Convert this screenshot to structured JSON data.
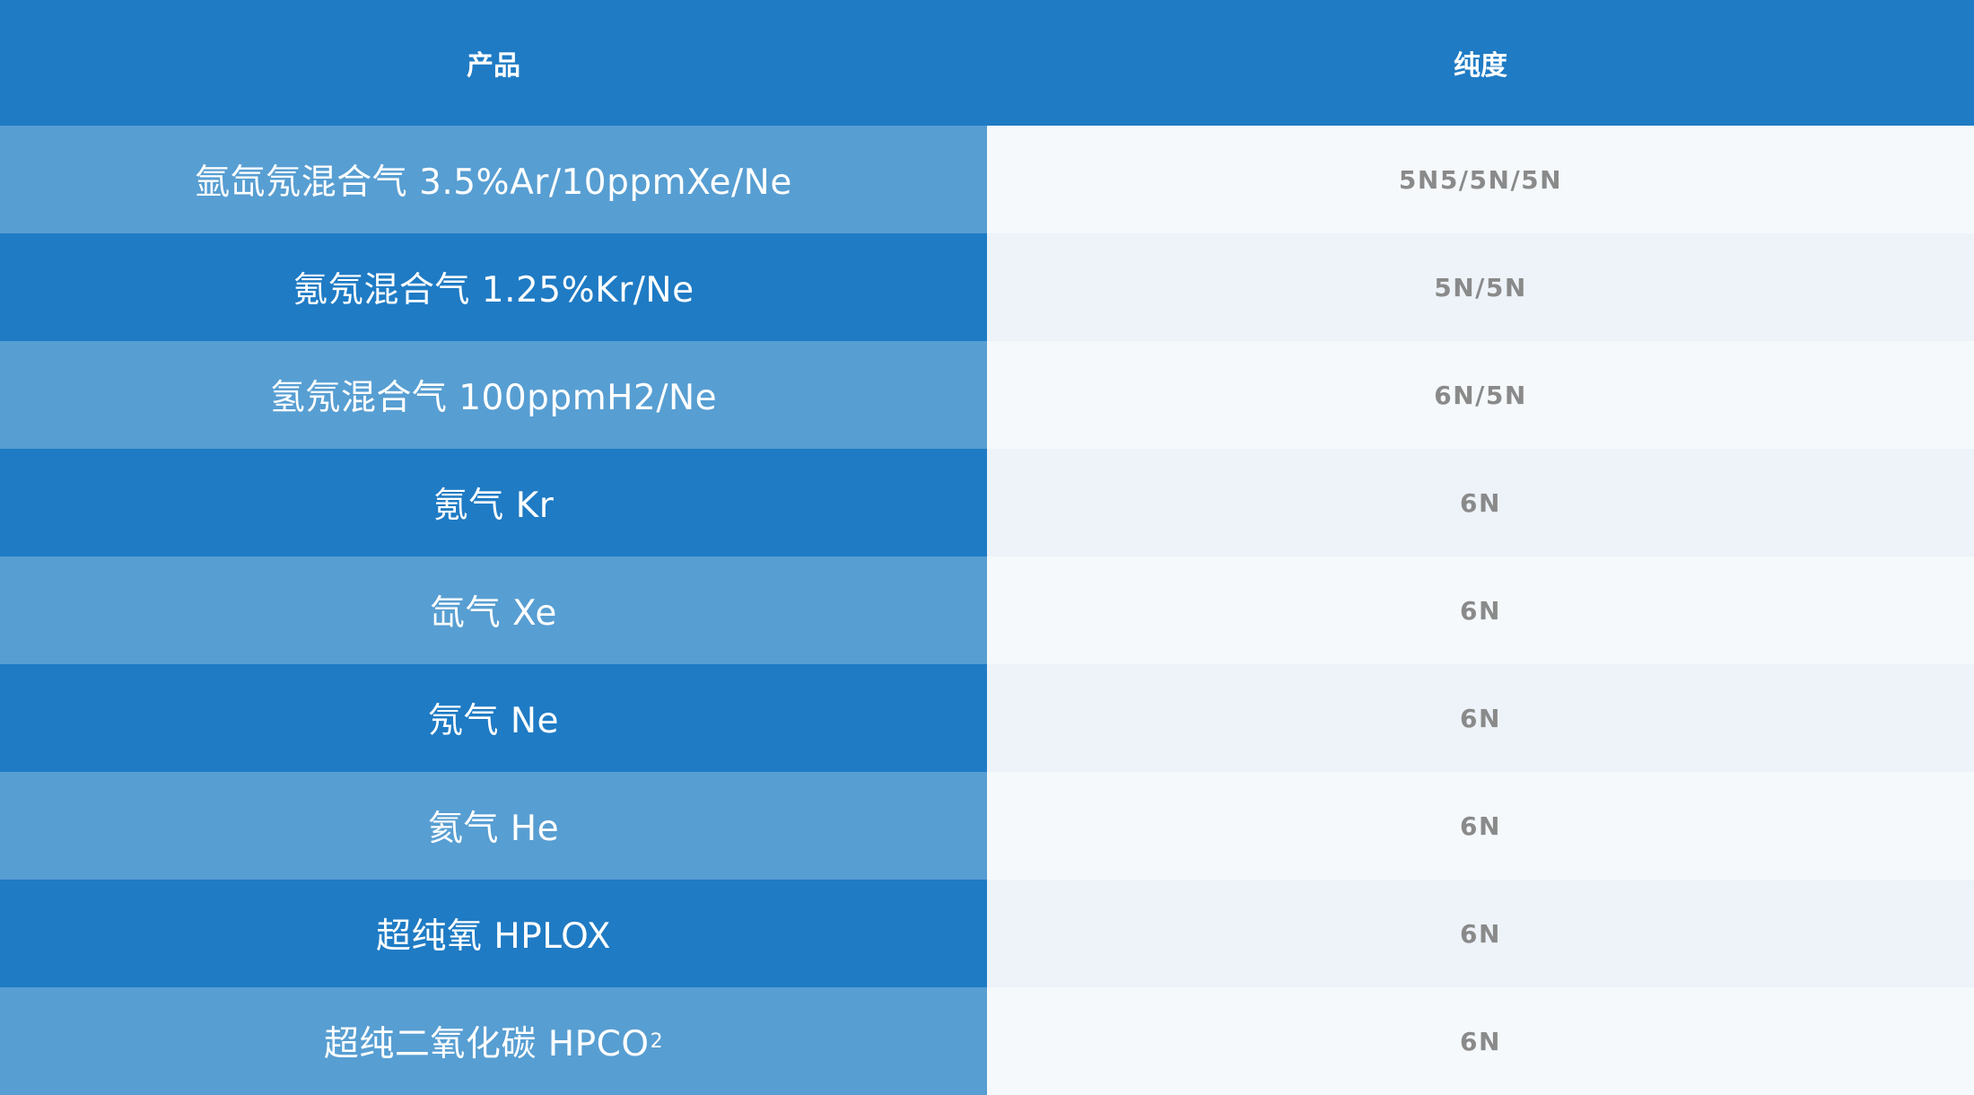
{
  "header": {
    "product_label": "产品",
    "purity_label": "纯度"
  },
  "rows": [
    {
      "product": "氩氙氖混合气 3.5%Ar/10ppmXe/Ne",
      "purity": "5N5/5N/5N"
    },
    {
      "product": "氪氖混合气 1.25%Kr/Ne",
      "purity": "5N/5N"
    },
    {
      "product": "氢氖混合气 100ppmH2/Ne",
      "purity": "6N/5N"
    },
    {
      "product": "氪气 Kr",
      "purity": "6N"
    },
    {
      "product": "氙气 Xe",
      "purity": "6N"
    },
    {
      "product": "氖气 Ne",
      "purity": "6N"
    },
    {
      "product": "氦气 He",
      "purity": "6N"
    },
    {
      "product": "超纯氧 HPLOX",
      "purity": "6N"
    },
    {
      "product": "超纯二氧化碳 HPCO",
      "product_subscript": "2",
      "purity": "6N"
    }
  ],
  "colors": {
    "header_bg": "#1f7bc4",
    "product_light_bg": "#579ed2",
    "product_dark_bg": "#1f7bc4",
    "purity_light_bg": "#f5f9fc",
    "purity_dark_bg": "#edf3f9",
    "purity_text": "#8a8a8a"
  }
}
